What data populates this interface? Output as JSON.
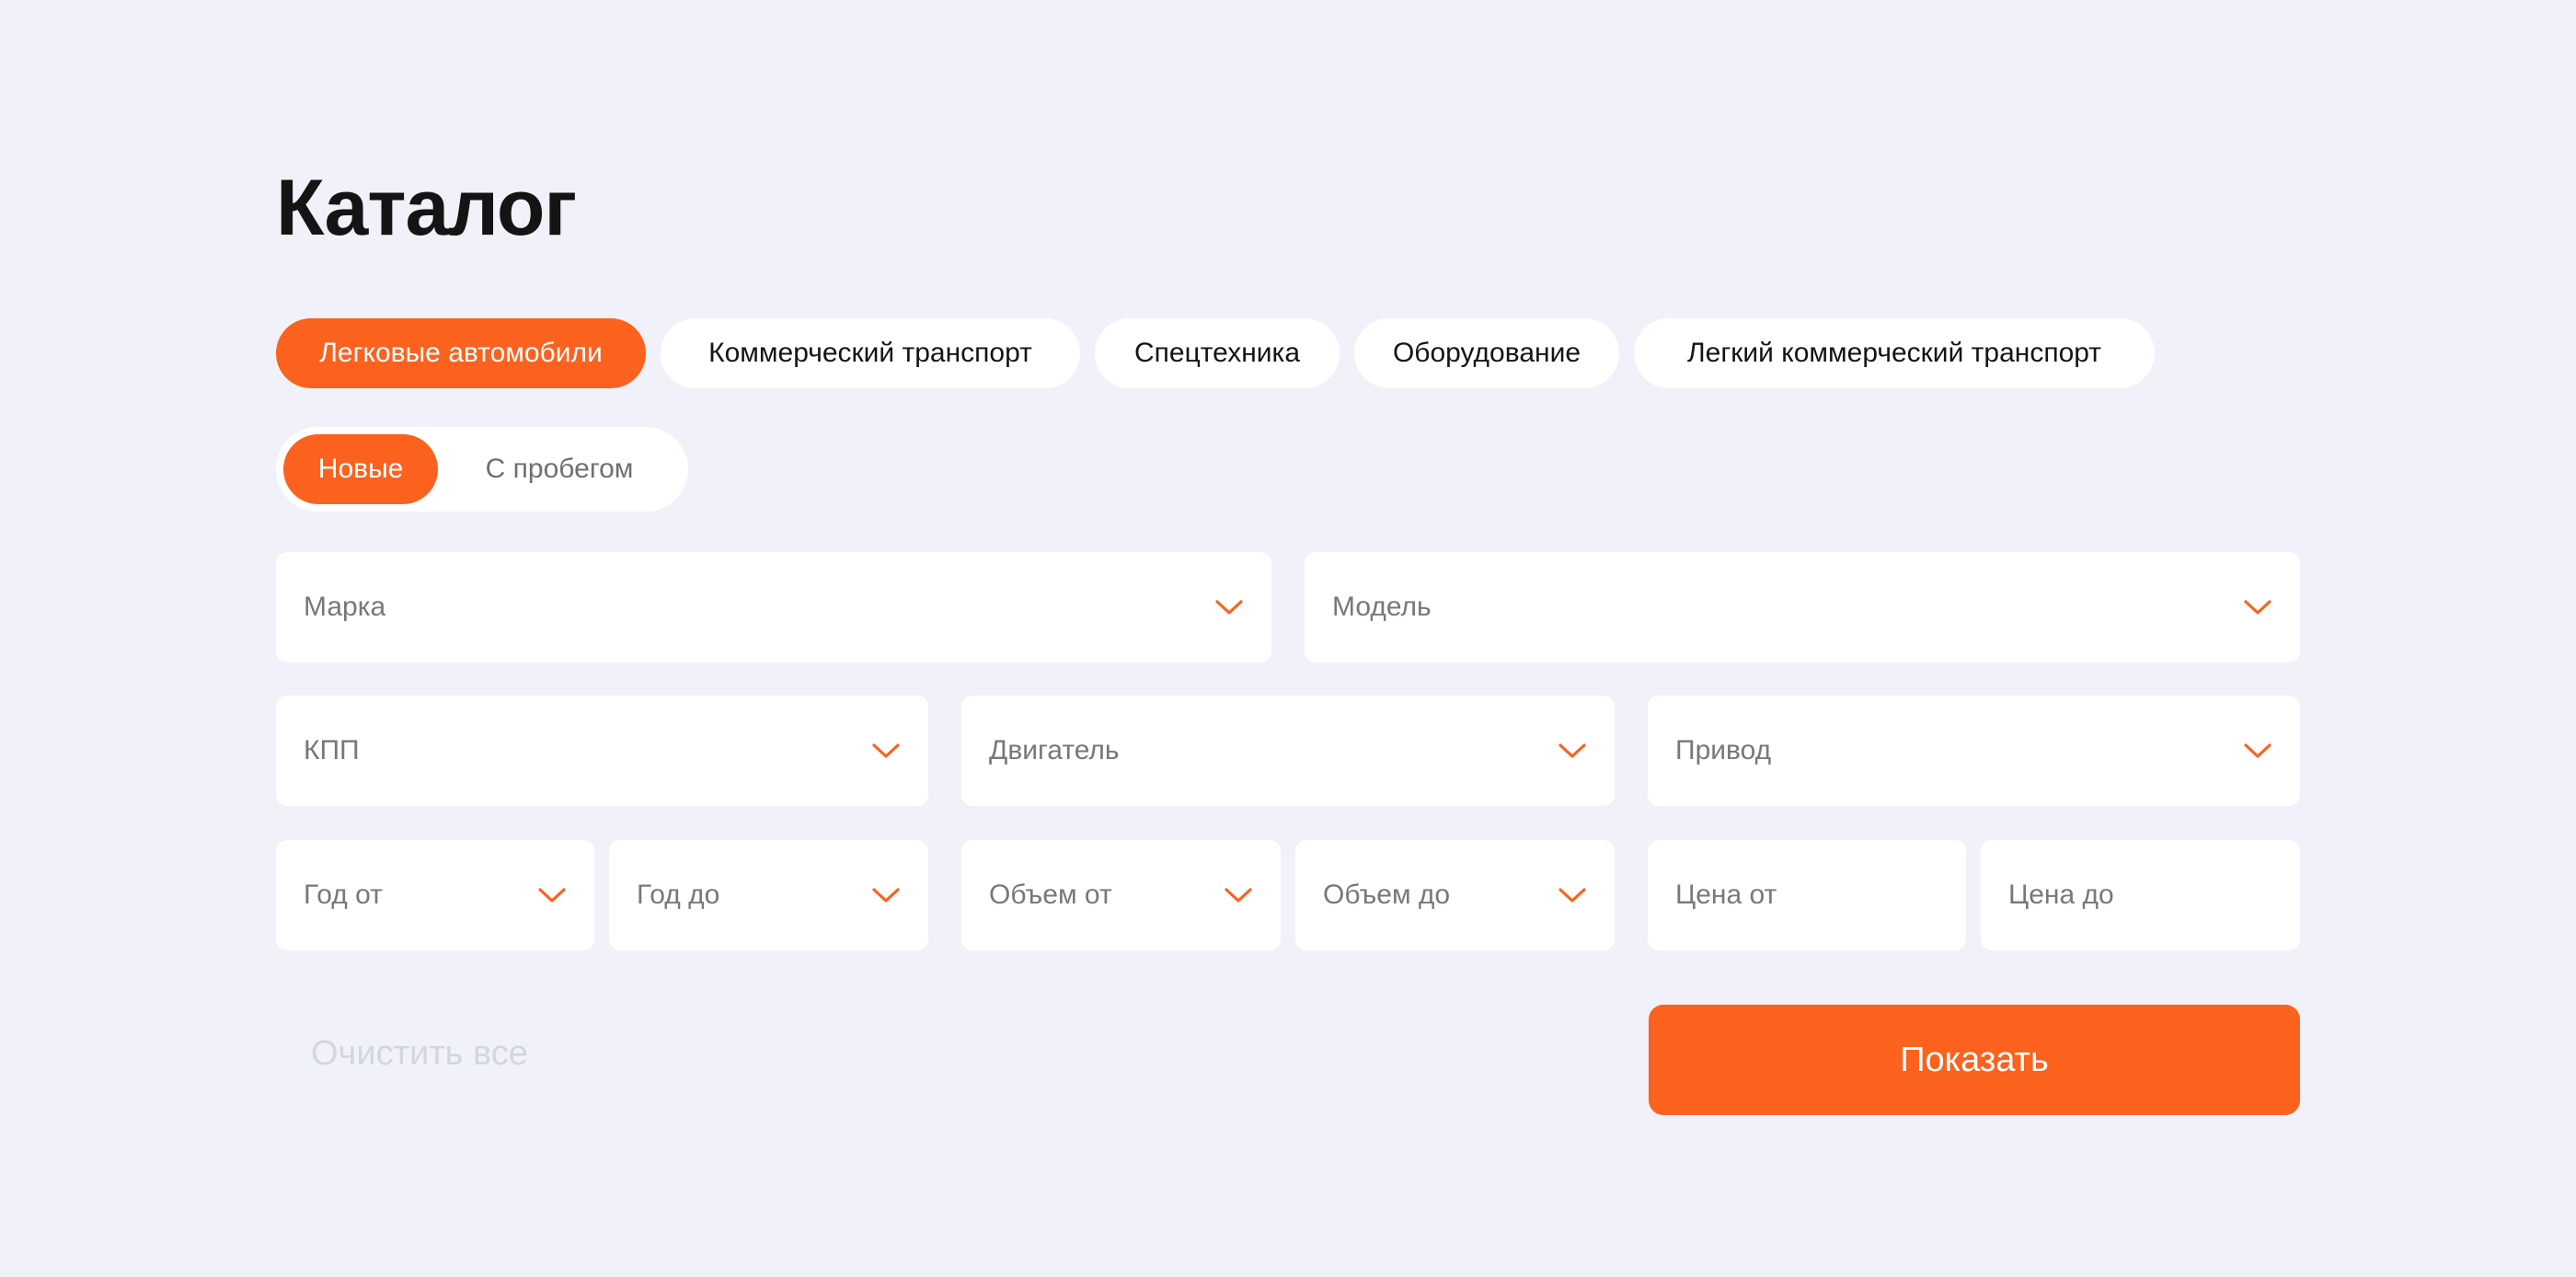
{
  "title": "Каталог",
  "accent_color": "#fb621e",
  "categories": [
    {
      "label": "Легковые автомобили",
      "active": true
    },
    {
      "label": "Коммерческий транспорт",
      "active": false
    },
    {
      "label": "Спецтехника",
      "active": false
    },
    {
      "label": "Оборудование",
      "active": false
    },
    {
      "label": "Легкий коммерческий транспорт",
      "active": false
    }
  ],
  "condition": [
    {
      "label": "Новые",
      "active": true
    },
    {
      "label": "С пробегом",
      "active": false
    }
  ],
  "filters": {
    "brand": "Марка",
    "model": "Модель",
    "transmission": "КПП",
    "engine": "Двигатель",
    "drive": "Привод",
    "year_from": "Год от",
    "year_to": "Год до",
    "volume_from": "Объем от",
    "volume_to": "Объем до",
    "price_from": "Цена от",
    "price_to": "Цена до"
  },
  "actions": {
    "clear": "Очистить все",
    "show": "Показать"
  },
  "icons": {
    "dropdown": "chevron-down-icon"
  }
}
